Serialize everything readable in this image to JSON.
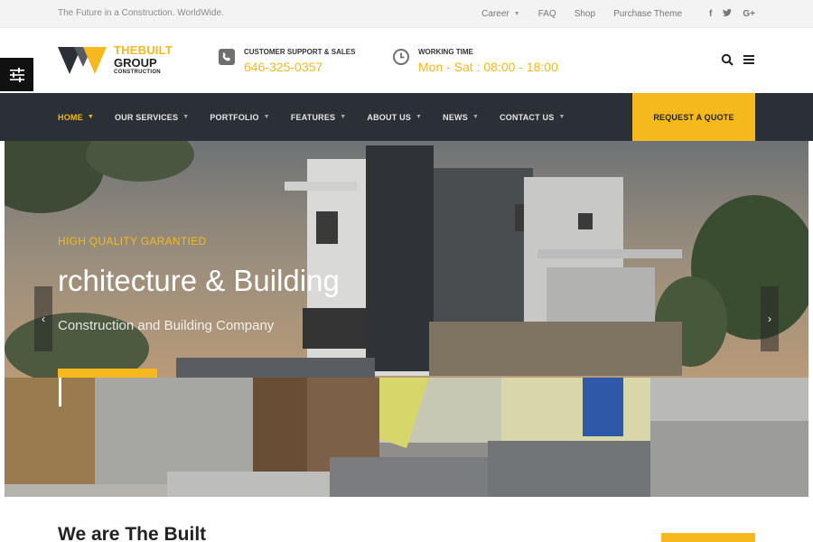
{
  "topbar": {
    "tagline": "The Future in a Construction. WorldWide.",
    "links": [
      {
        "label": "Career",
        "dropdown": true
      },
      {
        "label": "FAQ",
        "dropdown": false
      },
      {
        "label": "Shop",
        "dropdown": false
      },
      {
        "label": "Purchase Theme",
        "dropdown": false
      }
    ],
    "social": [
      "f",
      "twitter-icon",
      "G+"
    ]
  },
  "logo": {
    "line1": "THEBUILT",
    "line2": "GROUP",
    "line3": "CONSTRUCTION"
  },
  "support": {
    "label": "CUSTOMER SUPPORT & SALES",
    "value": "646-325-0357",
    "icon": "phone-icon"
  },
  "working": {
    "label": "WORKING TIME",
    "value": "Mon - Sat : 08:00 - 18:00",
    "icon": "clock-icon"
  },
  "nav": {
    "items": [
      {
        "label": "HOME"
      },
      {
        "label": "OUR SERVICES"
      },
      {
        "label": "PORTFOLIO"
      },
      {
        "label": "FEATURES"
      },
      {
        "label": "ABOUT US"
      },
      {
        "label": "NEWS"
      },
      {
        "label": "CONTACT US"
      }
    ],
    "cta": "REQUEST A QUOTE"
  },
  "hero": {
    "subtitle": "HIGH QUALITY GARANTIED",
    "title": "rchitecture & Building",
    "tagline": "Construction and Building Company"
  },
  "about": {
    "title": "We are The Built"
  },
  "colors": {
    "accent": "#f5b91e",
    "nav_bg": "#2b2f36",
    "topbar_bg": "#f3f3f3"
  }
}
